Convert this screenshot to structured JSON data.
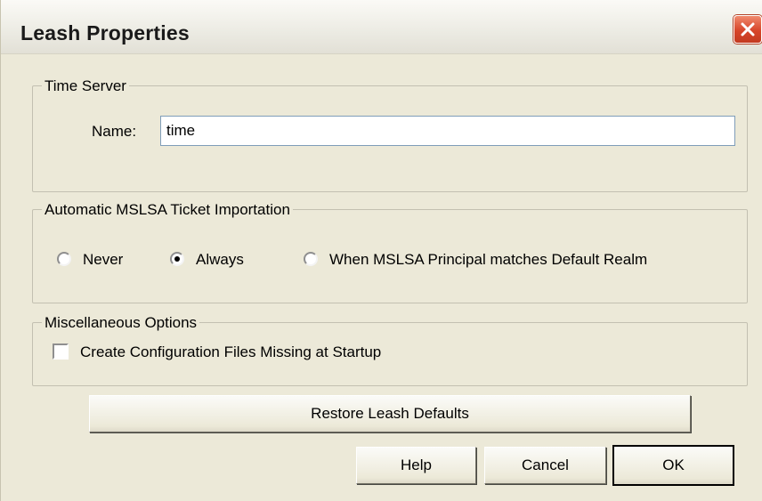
{
  "window": {
    "title": "Leash Properties"
  },
  "time_server": {
    "legend": "Time Server",
    "name_label": "Name:",
    "name_value": "time"
  },
  "mslsa": {
    "legend": "Automatic MSLSA Ticket Importation",
    "options": [
      {
        "label": "Never",
        "checked": false
      },
      {
        "label": "Always",
        "checked": true
      },
      {
        "label": "When MSLSA Principal matches Default Realm",
        "checked": false
      }
    ]
  },
  "misc": {
    "legend": "Miscellaneous Options",
    "checkbox_label": "Create Configuration Files Missing at Startup",
    "checkbox_checked": false
  },
  "buttons": {
    "restore_label": "Restore Leash Defaults",
    "help_label": "Help",
    "cancel_label": "Cancel",
    "ok_label": "OK"
  },
  "colors": {
    "dialog_background": "#ece9d8",
    "close_button": "#d7452a",
    "textbox_border": "#7f9db9"
  },
  "icons": {
    "close": "close-icon"
  }
}
